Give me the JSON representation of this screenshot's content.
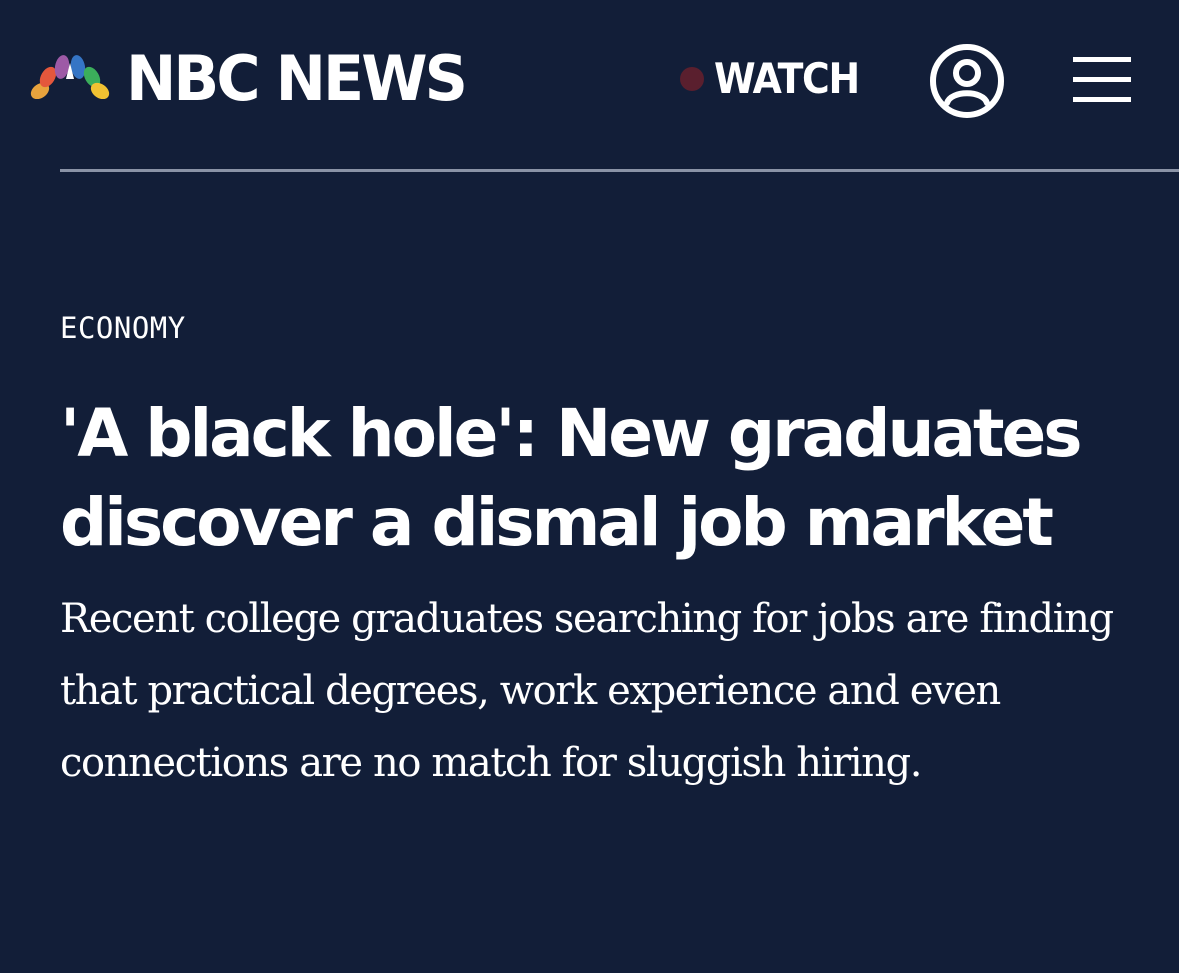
{
  "header": {
    "logo_text": "NBC NEWS",
    "watch_label": "WATCH",
    "colors": {
      "background": "#121e38",
      "live_dot": "#5a1f2e",
      "divider": "#8a93a6",
      "peacock": [
        "#e8a33d",
        "#e4573c",
        "#9d5aa6",
        "#3575c5",
        "#3bae5b",
        "#f1c232"
      ]
    },
    "icons": {
      "logo": "nbc-peacock-icon",
      "watch": "live-dot-icon",
      "account": "user-account-icon",
      "menu": "hamburger-menu-icon"
    }
  },
  "article": {
    "section": "ECONOMY",
    "headline_line1": "'A black hole': New graduates",
    "headline_line2": "discover a dismal job market",
    "dek": "Recent college graduates searching for jobs are finding that practical degrees, work experience and even connections are no match for sluggish hiring."
  }
}
